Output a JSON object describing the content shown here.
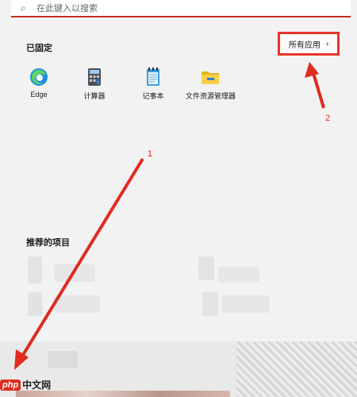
{
  "search": {
    "placeholder": "在此键入以搜索"
  },
  "pinned": {
    "title": "已固定",
    "all_apps_label": "所有应用",
    "all_apps_chevron": "›",
    "apps": [
      {
        "label": "Edge",
        "icon": "edge-icon"
      },
      {
        "label": "计算器",
        "icon": "calculator-icon"
      },
      {
        "label": "记事本",
        "icon": "notepad-icon"
      },
      {
        "label": "文件资源管理器",
        "icon": "folder-icon"
      }
    ]
  },
  "recommended": {
    "title": "推荐的项目"
  },
  "annotations": {
    "arrow1": "1",
    "arrow2": "2"
  },
  "watermark": {
    "brand": "php",
    "site": "中文网"
  },
  "colors": {
    "annotation": "#e02b20",
    "search_underline": "#c42b1c"
  }
}
